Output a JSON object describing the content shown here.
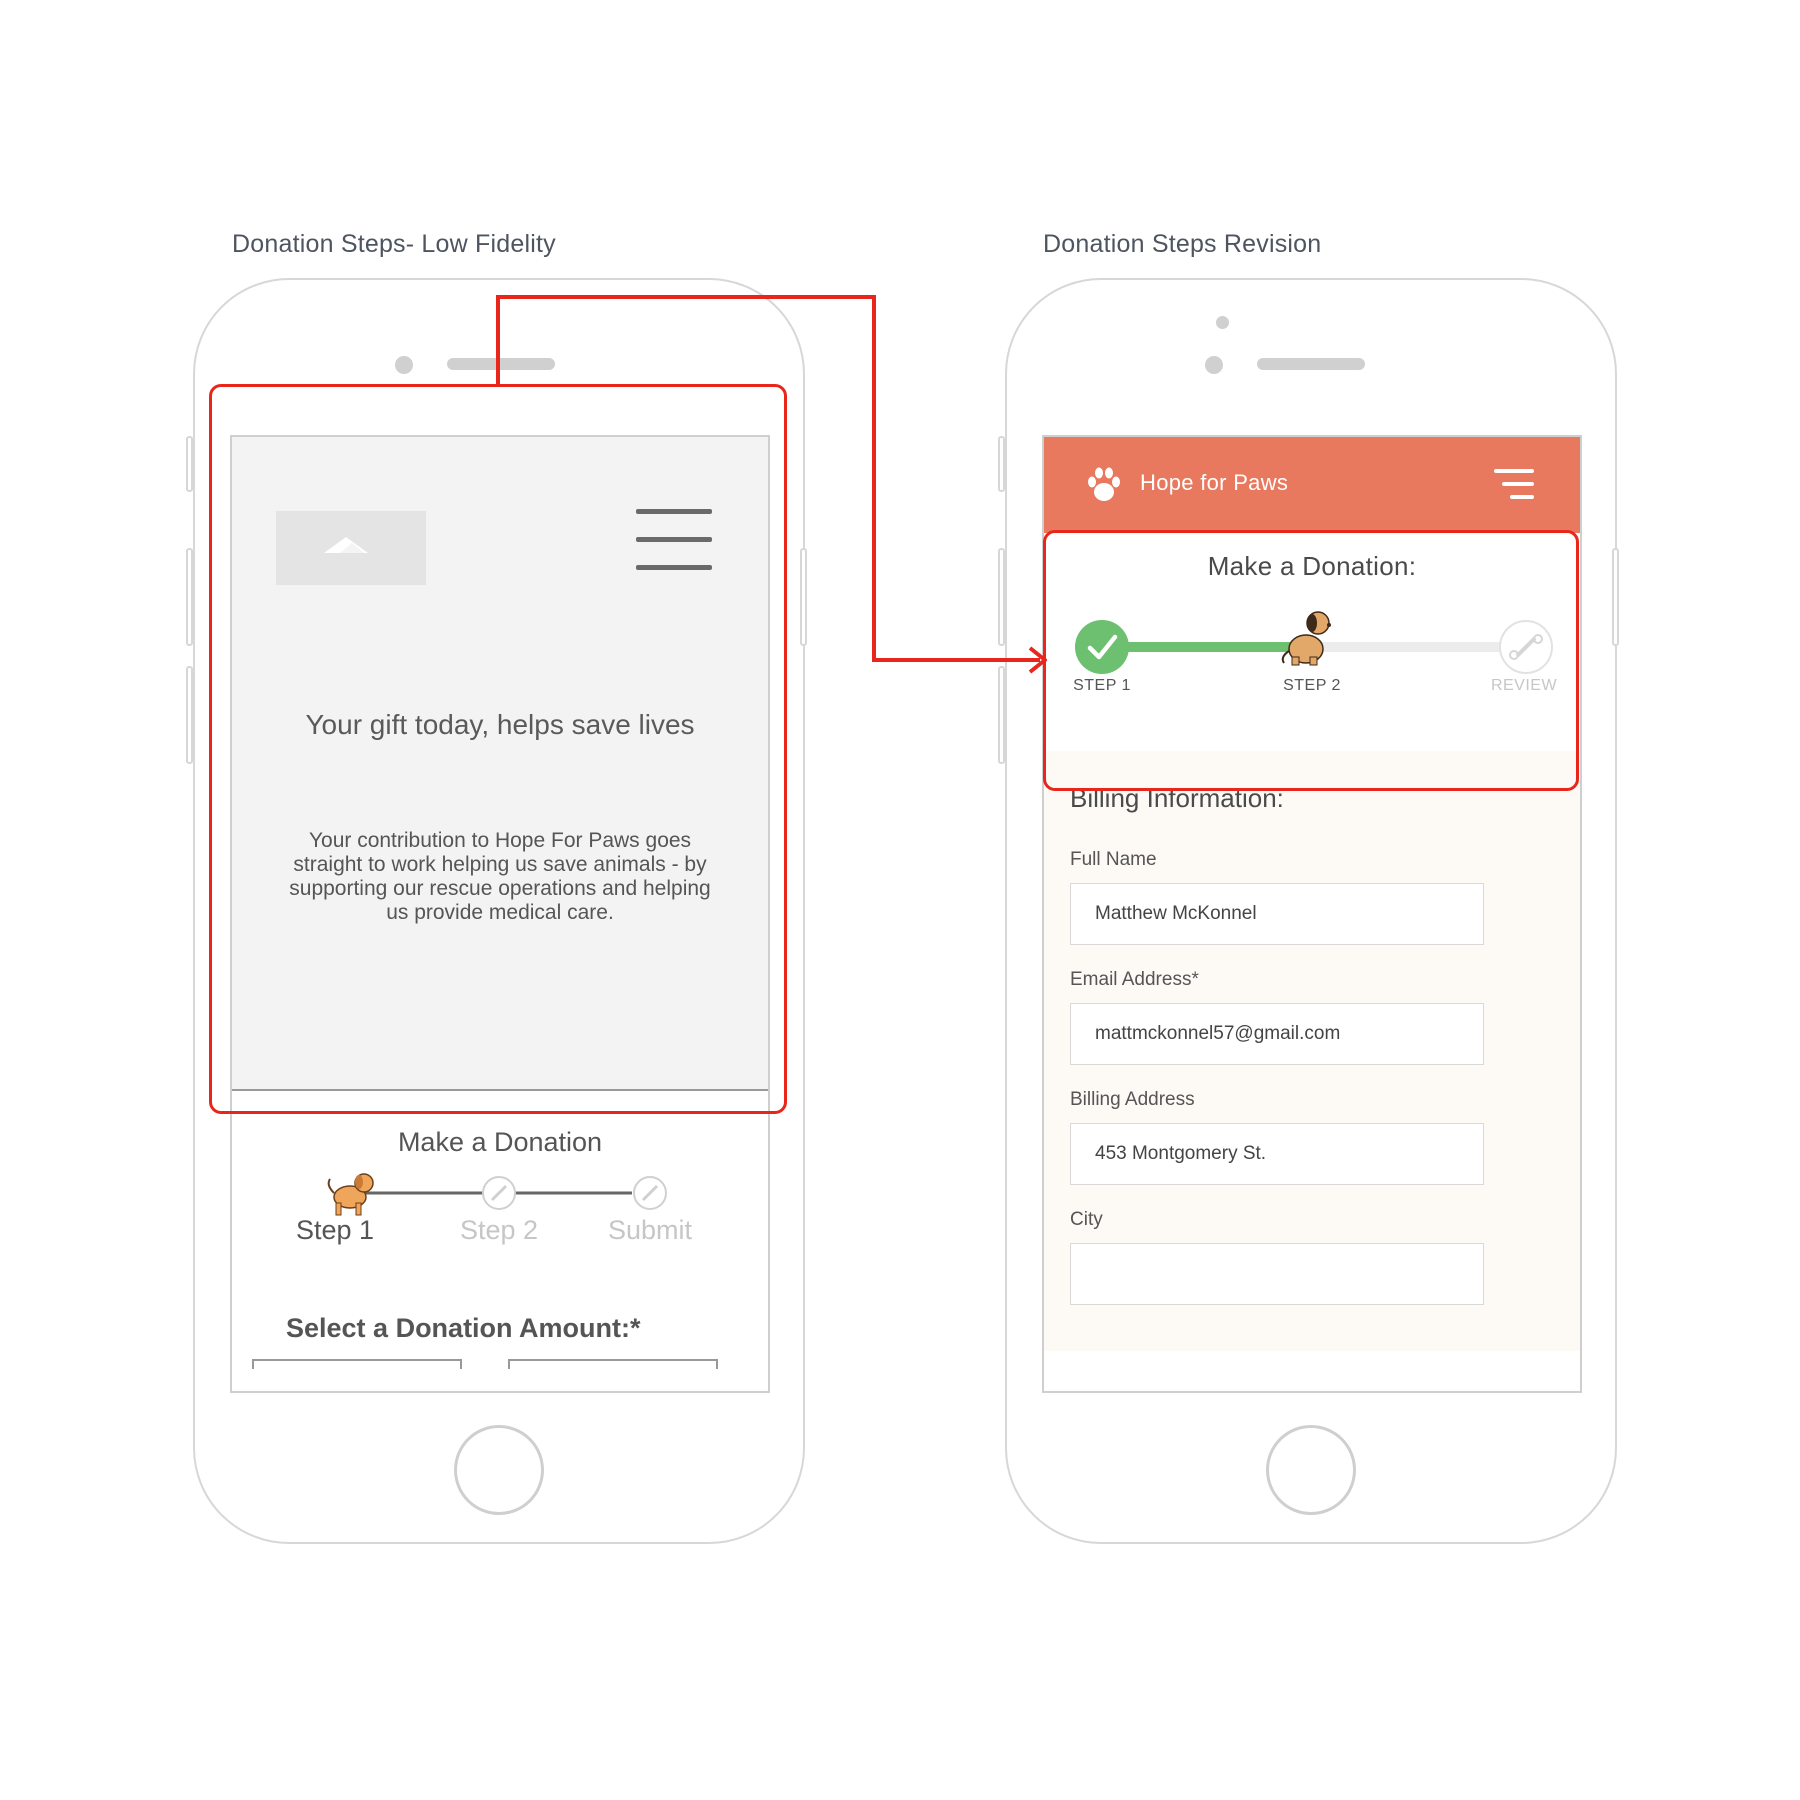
{
  "captions": {
    "left": "Donation Steps- Low Fidelity",
    "right": "Donation Steps Revision"
  },
  "wireframe": {
    "hero_title": "Your gift today, helps save lives",
    "hero_body": "Your contribution to Hope For Paws goes straight to work helping us save animals - by supporting our rescue operations and helping us provide medical care.",
    "make_donation": "Make a Donation",
    "steps": [
      "Step 1",
      "Step 2",
      "Submit"
    ],
    "active_step": 1,
    "select_amount": "Select a Donation Amount:*"
  },
  "revision": {
    "brand": "Hope for Paws",
    "make_donation": "Make a Donation:",
    "steps": [
      "STEP 1",
      "STEP 2",
      "REVIEW"
    ],
    "current_step": 2,
    "billing_heading": "Billing Information:",
    "fields": [
      {
        "label": "Full Name",
        "value": "Matthew McKonnel"
      },
      {
        "label": "Email Address*",
        "value": "mattmckonnel57@gmail.com"
      },
      {
        "label": "Billing Address",
        "value": "453 Montgomery St."
      },
      {
        "label": "City",
        "value": ""
      }
    ]
  },
  "colors": {
    "brand": "#e8795e",
    "highlight": "#e8261b",
    "step_complete": "#6cc070",
    "inactive_text": "#c6c6c6"
  }
}
